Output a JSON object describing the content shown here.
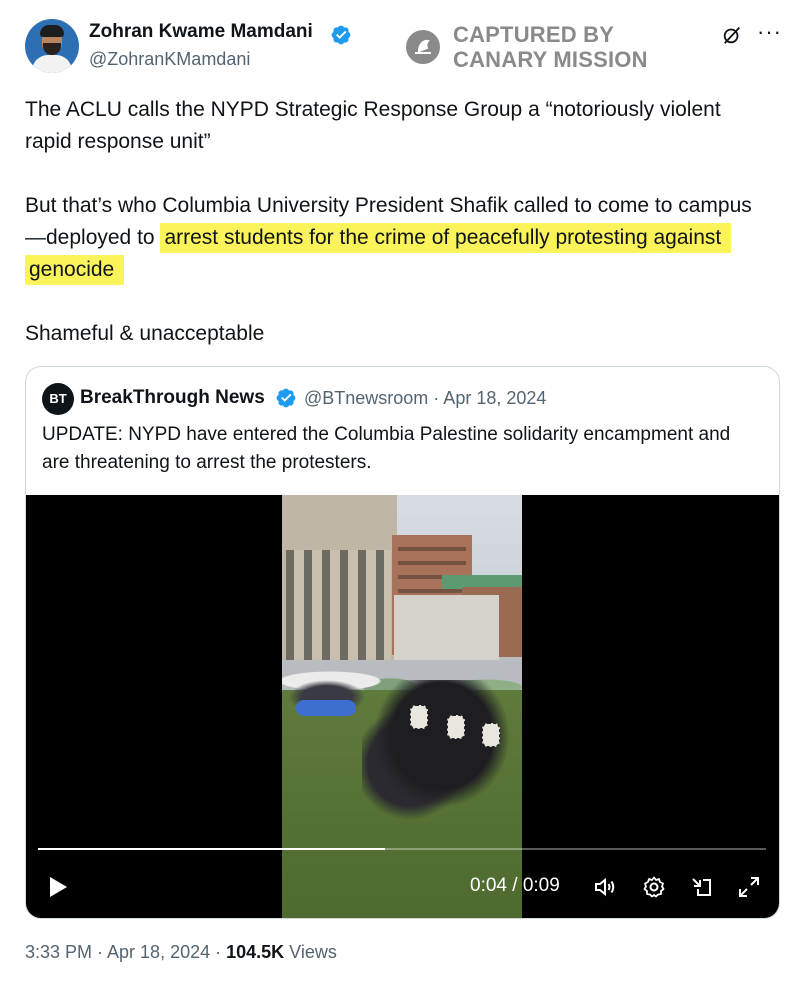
{
  "author": {
    "name": "Zohran Kwame Mamdani",
    "handle": "@ZohranKMamdani"
  },
  "watermark": {
    "line1": "CAPTURED BY",
    "line2": "CANARY MISSION"
  },
  "tweet": {
    "para1": "The ACLU calls the NYPD Strategic Response Group a “notoriously violent rapid response unit”",
    "para2_plain": "But that’s who Columbia University President Shafik called to come to campus—deployed to",
    "para2_highlight": "arrest students for the crime of peacefully protesting against genocide",
    "para3": "Shameful & unacceptable"
  },
  "quote": {
    "avatar_text": "BT",
    "name": "BreakThrough News",
    "handle_date": "@BTnewsroom · Apr 18, 2024",
    "text": "UPDATE: NYPD have entered the Columbia Palestine solidarity encampment and are threatening to arrest the protesters."
  },
  "video": {
    "current_time": "0:04",
    "duration": "0:09",
    "time_display": "0:04 / 0:09",
    "progress_fraction": 0.477
  },
  "meta": {
    "time_date": "3:33 PM · Apr 18, 2024 · ",
    "views_count": "104.5K",
    "views_label": " Views"
  },
  "colors": {
    "highlight": "#fbf35a",
    "verified": "#1d9bf0",
    "secondary_text": "#536471",
    "watermark": "#8a8a8a"
  },
  "icons": [
    "verified-badge-icon",
    "canary-logo-icon",
    "grok-icon",
    "more-icon",
    "play-icon",
    "volume-icon",
    "gear-icon",
    "dock-icon",
    "expand-icon"
  ]
}
